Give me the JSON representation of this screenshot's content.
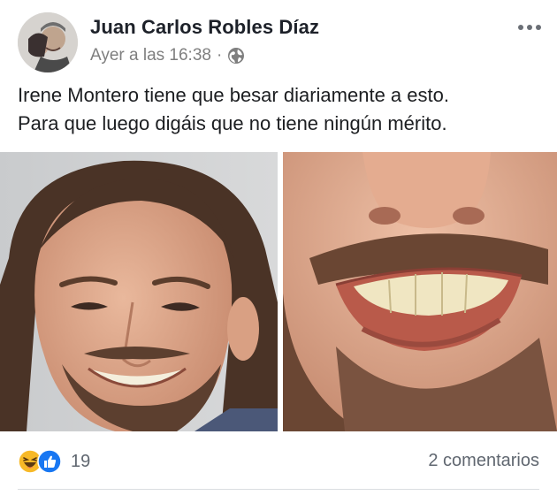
{
  "post": {
    "author": "Juan Carlos Robles Díaz",
    "timestamp": "Ayer a las 16:38",
    "separator": "·",
    "privacy_icon": "globe-icon",
    "menu_icon": "more-options-icon",
    "text_lines": [
      "Irene Montero tiene que besar diariamente a esto.",
      "Para que luego digáis que no tiene ningún mérito."
    ]
  },
  "photos": [
    {
      "description_icon": "photo-smiling-man"
    },
    {
      "description_icon": "photo-smile-closeup"
    }
  ],
  "footer": {
    "reaction_icons": [
      "haha-reaction-icon",
      "like-reaction-icon"
    ],
    "reaction_count": "19",
    "comments_label": "2 comentarios"
  },
  "colors": {
    "like_blue": "#1877f2",
    "haha_yellow": "#f7b928",
    "secondary_text": "#606770",
    "divider": "#dadde1"
  }
}
